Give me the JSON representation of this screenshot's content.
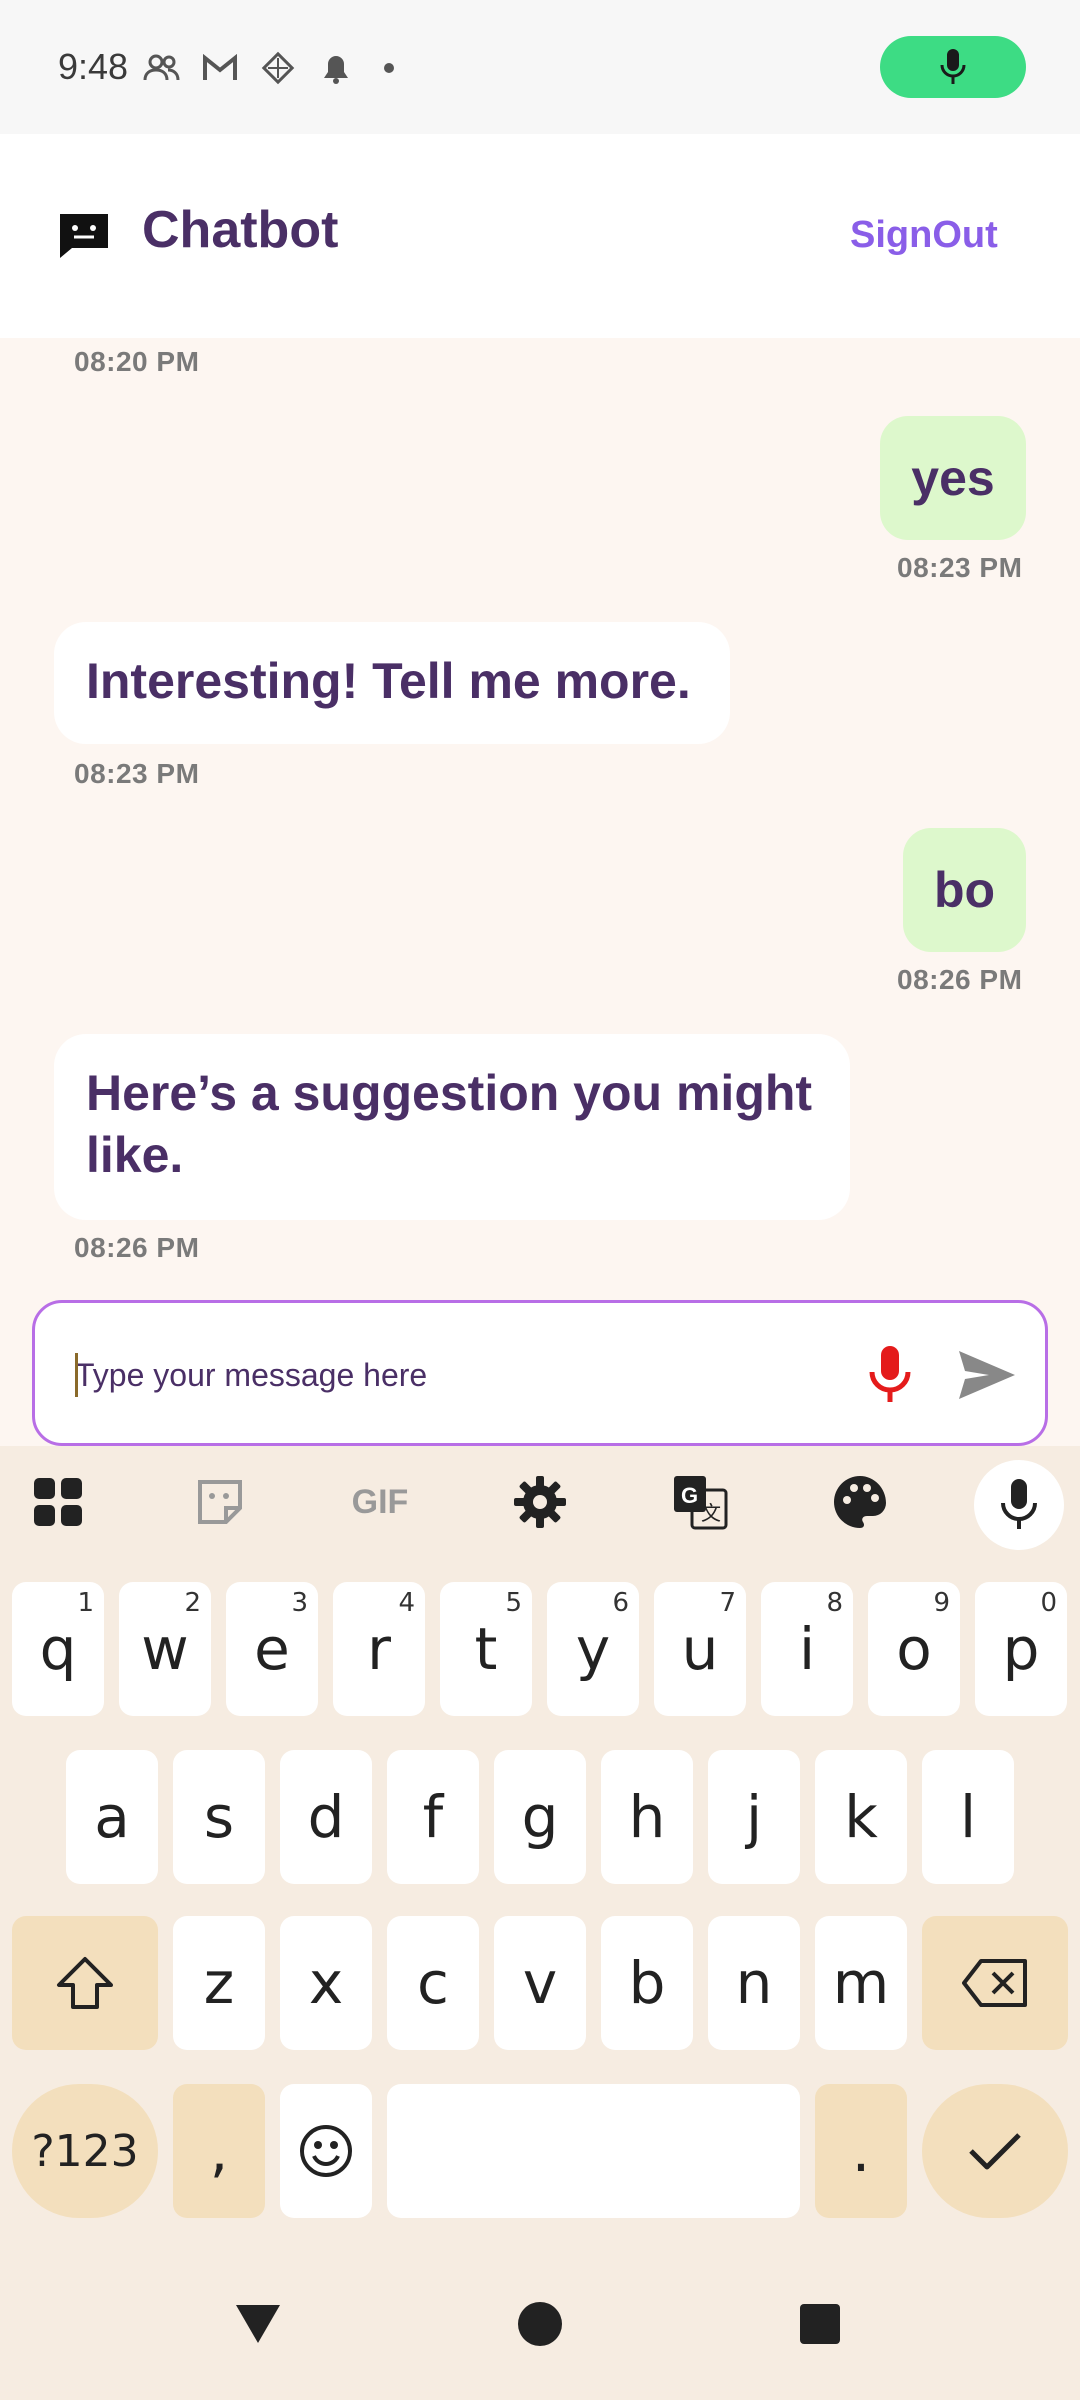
{
  "status_bar": {
    "time": "9:48",
    "icons": [
      "people-icon",
      "gmail-icon",
      "diamond-icon",
      "bell-icon",
      "dot-icon"
    ],
    "mic_indicator_color": "#3ddc84"
  },
  "app_bar": {
    "title": "Chatbot",
    "signout_label": "SignOut",
    "title_color": "#4a2f66",
    "accent": "#8a5ee8"
  },
  "messages": [
    {
      "sender": "bot",
      "text": "",
      "time": "08:20 PM"
    },
    {
      "sender": "user",
      "text": "yes",
      "time": "08:23 PM"
    },
    {
      "sender": "bot",
      "text": "Interesting! Tell me more.",
      "time": "08:23 PM"
    },
    {
      "sender": "user",
      "text": "bo",
      "time": "08:26 PM"
    },
    {
      "sender": "bot",
      "text": "Here’s a suggestion you might like.",
      "time": "08:26 PM"
    }
  ],
  "input": {
    "placeholder": "Type your message here",
    "value": ""
  },
  "keyboard": {
    "toolbar": [
      "apps-icon",
      "sticker-icon",
      "GIF",
      "settings-icon",
      "translate-icon",
      "palette-icon",
      "mic-icon"
    ],
    "row1": [
      {
        "k": "q",
        "n": "1"
      },
      {
        "k": "w",
        "n": "2"
      },
      {
        "k": "e",
        "n": "3"
      },
      {
        "k": "r",
        "n": "4"
      },
      {
        "k": "t",
        "n": "5"
      },
      {
        "k": "y",
        "n": "6"
      },
      {
        "k": "u",
        "n": "7"
      },
      {
        "k": "i",
        "n": "8"
      },
      {
        "k": "o",
        "n": "9"
      },
      {
        "k": "p",
        "n": "0"
      }
    ],
    "row2": [
      "a",
      "s",
      "d",
      "f",
      "g",
      "h",
      "j",
      "k",
      "l"
    ],
    "row3": [
      "z",
      "x",
      "c",
      "v",
      "b",
      "n",
      "m"
    ],
    "symbols_label": "?123",
    "comma": ",",
    "period": "."
  }
}
